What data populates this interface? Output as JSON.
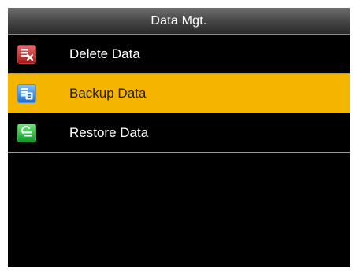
{
  "header": {
    "title": "Data Mgt."
  },
  "menu": {
    "items": [
      {
        "label": "Delete Data",
        "icon": "delete-data-icon",
        "selected": false
      },
      {
        "label": "Backup Data",
        "icon": "backup-data-icon",
        "selected": true
      },
      {
        "label": "Restore Data",
        "icon": "restore-data-icon",
        "selected": false
      }
    ]
  },
  "colors": {
    "background": "#000000",
    "highlight": "#f5b400",
    "text": "#ffffff",
    "divider": "#9a9a9a"
  }
}
